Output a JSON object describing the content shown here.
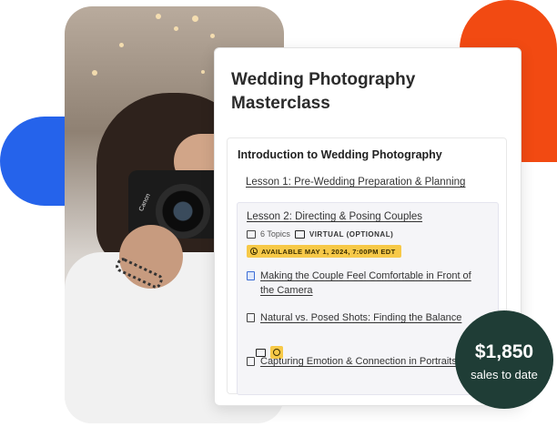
{
  "card": {
    "title": "Wedding Photography Masterclass",
    "section_title": "Introduction to Wedding Photography",
    "lesson1": "Lesson 1: Pre-Wedding Preparation & Planning",
    "lesson2": {
      "title": "Lesson 2: Directing & Posing Couples",
      "topics_count": "6 Topics",
      "mode": "VIRTUAL (OPTIONAL)",
      "availability": "AVAILABLE  MAY 1, 2024,  7:00PM EDT",
      "topics": [
        "Making the Couple Feel Comfortable in Front of the Camera",
        "Natural vs. Posed Shots: Finding the Balance",
        "Capturing Emotion & Connection in Portraits"
      ]
    }
  },
  "sales": {
    "amount": "$1,850",
    "label": "sales to date"
  },
  "colors": {
    "accent_orange": "#f24a12",
    "accent_blue": "#2563eb",
    "badge_yellow": "#f7c948",
    "sales_bg": "#1f3d36"
  },
  "photo": {
    "camera_brand": "Canon"
  }
}
